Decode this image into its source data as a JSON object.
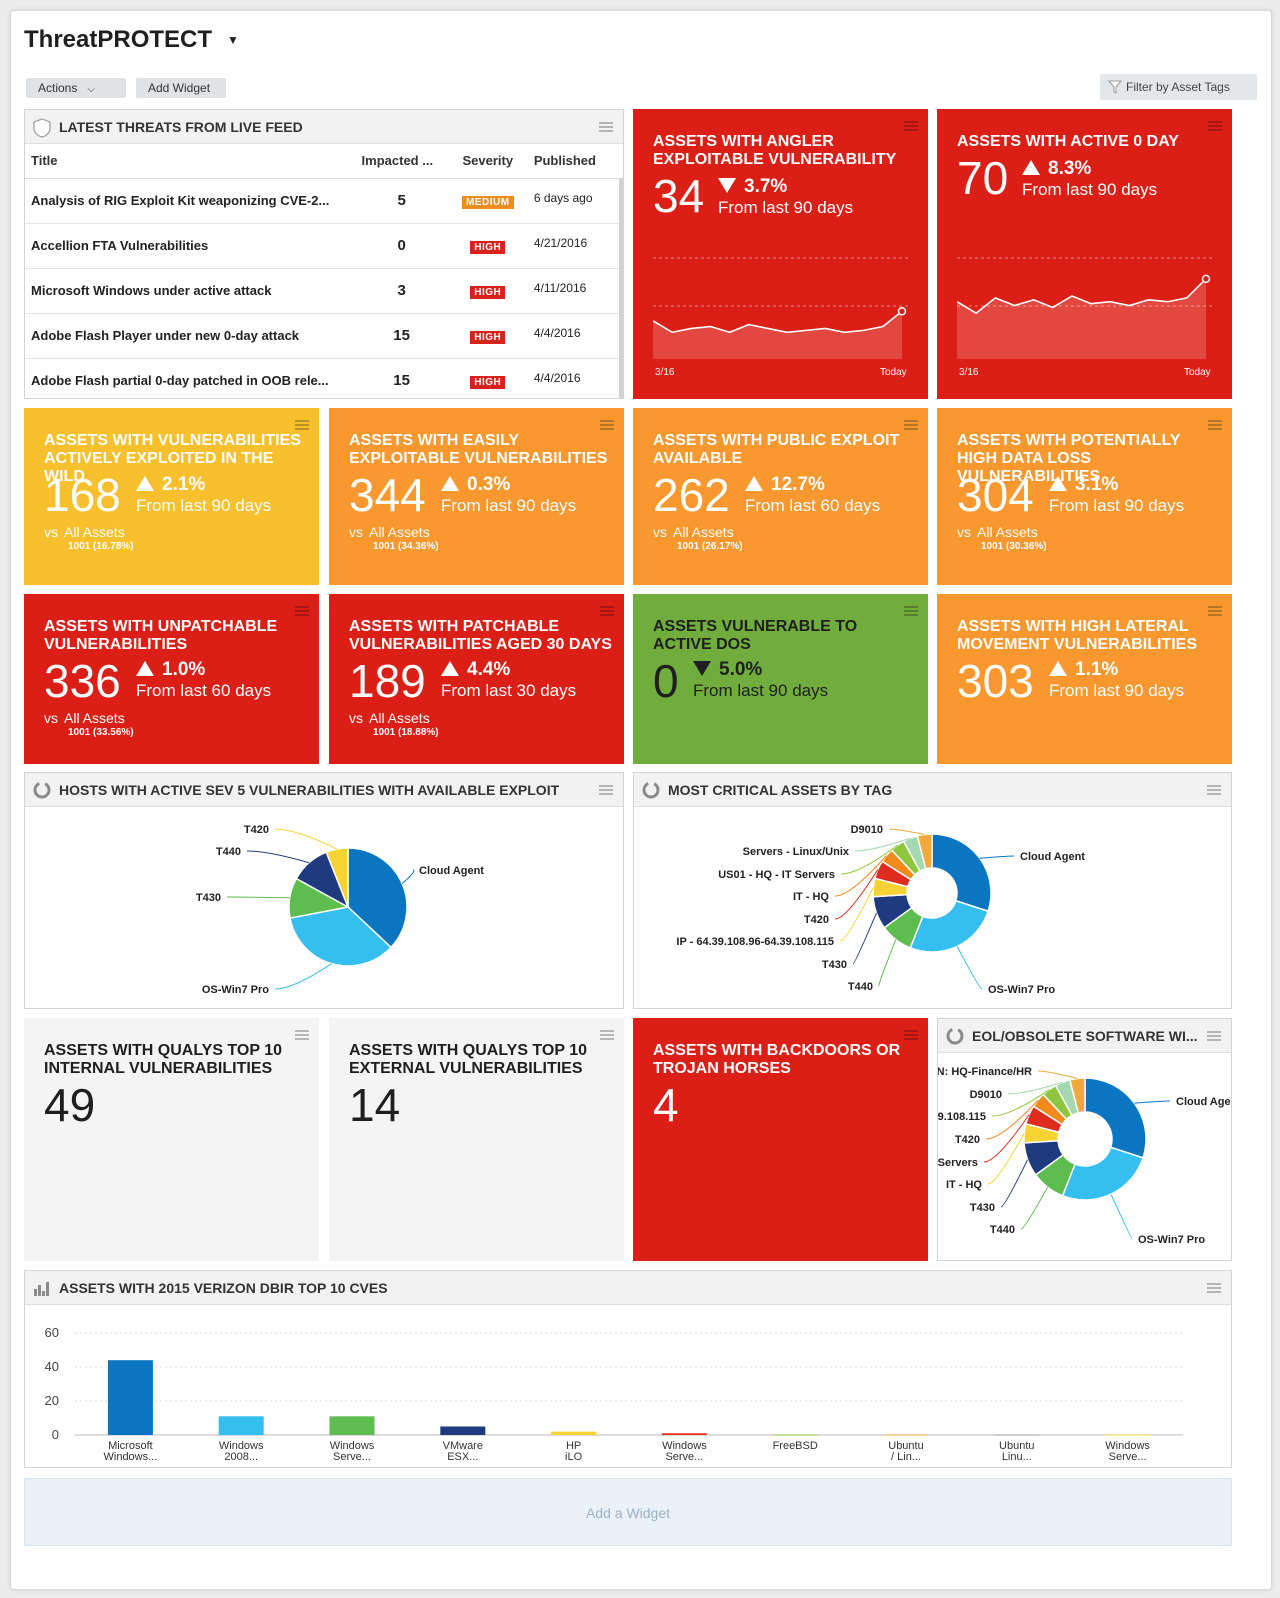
{
  "header": {
    "title": "ThreatPROTECT",
    "actions_label": "Actions",
    "add_widget_label": "Add Widget",
    "filter_label": "Filter by Asset Tags"
  },
  "threats": {
    "title": "LATEST THREATS FROM LIVE FEED",
    "columns": [
      "Title",
      "Impacted ...",
      "Severity",
      "Published"
    ],
    "rows": [
      {
        "title": "Analysis of RIG Exploit Kit weaponizing CVE-2...",
        "impacted": "5",
        "severity": "MEDIUM",
        "published": "6 days ago"
      },
      {
        "title": "Accellion FTA Vulnerabilities",
        "impacted": "0",
        "severity": "HIGH",
        "published": "4/21/2016"
      },
      {
        "title": "Microsoft Windows under active attack",
        "impacted": "3",
        "severity": "HIGH",
        "published": "4/11/2016"
      },
      {
        "title": "Adobe Flash Player under new 0-day attack",
        "impacted": "15",
        "severity": "HIGH",
        "published": "4/4/2016"
      },
      {
        "title": "Adobe Flash partial 0-day patched in OOB rele...",
        "impacted": "15",
        "severity": "HIGH",
        "published": "4/4/2016"
      }
    ],
    "severity_colors": {
      "MEDIUM": "#f08c1e",
      "HIGH": "#d8231c"
    }
  },
  "sparks": [
    {
      "title": "ASSETS WITH ANGLER EXPLOITABLE VULNERABILITY",
      "value": "34",
      "pct": "3.7%",
      "dir": "down",
      "sub": "From last 90 days",
      "start_label": "3/16",
      "end_label": "Today",
      "trend": [
        40,
        34,
        36,
        37,
        34,
        38,
        36,
        34,
        35,
        36,
        34,
        35,
        37,
        45
      ]
    },
    {
      "title": "ASSETS WITH ACTIVE 0 DAY",
      "value": "70",
      "pct": "8.3%",
      "dir": "up",
      "sub": "From last 90 days",
      "start_label": "3/16",
      "end_label": "Today",
      "trend": [
        50,
        44,
        52,
        48,
        51,
        47,
        53,
        49,
        50,
        48,
        51,
        50,
        52,
        62
      ]
    }
  ],
  "tiles": [
    {
      "title": "ASSETS WITH VULNERABILITIES ACTIVELY EXPLOITED IN THE WILD",
      "value": "168",
      "pct": "2.1%",
      "dir": "up",
      "sub": "From last 90 days",
      "vs": "vs",
      "vs_label": "All Assets",
      "vs_total": "1001",
      "vs_pct": "(16.78%)",
      "color": "#f9c02d"
    },
    {
      "title": "ASSETS WITH EASILY EXPLOITABLE VULNERABILITIES",
      "value": "344",
      "pct": "0.3%",
      "dir": "up",
      "sub": "From last 90 days",
      "vs": "vs",
      "vs_label": "All Assets",
      "vs_total": "1001",
      "vs_pct": "(34.36%)",
      "color": "#f9982f"
    },
    {
      "title": "ASSETS WITH PUBLIC EXPLOIT AVAILABLE",
      "value": "262",
      "pct": "12.7%",
      "dir": "up",
      "sub": "From last 60 days",
      "vs": "vs",
      "vs_label": "All Assets",
      "vs_total": "1001",
      "vs_pct": "(26.17%)",
      "color": "#f9982f"
    },
    {
      "title": "ASSETS WITH POTENTIALLY HIGH DATA LOSS VULNERABILITIES",
      "value": "304",
      "pct": "3.1%",
      "dir": "up",
      "sub": "From last 90 days",
      "vs": "vs",
      "vs_label": "All Assets",
      "vs_total": "1001",
      "vs_pct": "(30.36%)",
      "color": "#f9982f"
    },
    {
      "title": "ASSETS WITH UNPATCHABLE VULNERABILITIES",
      "value": "336",
      "pct": "1.0%",
      "dir": "up",
      "sub": "From last 60 days",
      "vs": "vs",
      "vs_label": "All Assets",
      "vs_total": "1001",
      "vs_pct": "(33.56%)",
      "color": "#dc1f16"
    },
    {
      "title": "ASSETS WITH PATCHABLE VULNERABILITIES AGED 30 DAYS",
      "value": "189",
      "pct": "4.4%",
      "dir": "up",
      "sub": "From last 30 days",
      "vs": "vs",
      "vs_label": "All Assets",
      "vs_total": "1001",
      "vs_pct": "(18.88%)",
      "color": "#dc1f16"
    },
    {
      "title": "ASSETS VULNERABLE TO ACTIVE DOS",
      "value": "0",
      "pct": "5.0%",
      "dir": "down",
      "sub": "From last 90 days",
      "color": "#70ad3c",
      "dark": true
    },
    {
      "title": "ASSETS WITH HIGH LATERAL MOVEMENT VULNERABILITIES",
      "value": "303",
      "pct": "1.1%",
      "dir": "up",
      "sub": "From last 90 days",
      "color": "#f9982f"
    }
  ],
  "simple_tiles": [
    {
      "title": "ASSETS WITH QUALYS TOP 10 INTERNAL VULNERABILITIES",
      "value": "49",
      "color": "#f4f4f4",
      "dark": true
    },
    {
      "title": "ASSETS WITH QUALYS TOP 10 EXTERNAL VULNERABILITIES",
      "value": "14",
      "color": "#f4f4f4",
      "dark": true
    },
    {
      "title": "ASSETS WITH BACKDOORS OR TROJAN HORSES",
      "value": "4",
      "color": "#dc1f16"
    }
  ],
  "pies": {
    "hosts_title": "HOSTS WITH ACTIVE SEV 5 VULNERABILITIES WITH AVAILABLE EXPLOIT",
    "critical_title": "MOST CRITICAL ASSETS BY TAG",
    "eol_title": "EOL/OBSOLETE SOFTWARE WI..."
  },
  "chart_data": [
    {
      "type": "pie",
      "title": "HOSTS WITH ACTIVE SEV 5 VULNERABILITIES WITH AVAILABLE EXPLOIT",
      "labels": [
        "Cloud Agent",
        "OS-Win7 Pro",
        "T430",
        "T440",
        "T420"
      ],
      "values": [
        37,
        35,
        11,
        11,
        6
      ],
      "colors": [
        "#0a76c2",
        "#35bef0",
        "#5ebd4f",
        "#1f3b7f",
        "#f6d332"
      ]
    },
    {
      "type": "pie",
      "title": "MOST CRITICAL ASSETS BY TAG",
      "labels": [
        "Cloud Agent",
        "OS-Win7 Pro",
        "T440",
        "T430",
        "IP - 64.39.108.96-64.39.108.115",
        "T420",
        "IT - HQ",
        "US01 - HQ - IT Servers",
        "Servers - Linux/Unix",
        "D9010"
      ],
      "values": [
        30,
        26,
        9,
        9,
        5,
        5,
        4,
        4,
        4,
        4
      ],
      "colors": [
        "#0a76c2",
        "#35bef0",
        "#5ebd4f",
        "#1f3b7f",
        "#f6d332",
        "#e02c1f",
        "#f28a1c",
        "#8ec63f",
        "#a4d8b0",
        "#f2a93b"
      ]
    },
    {
      "type": "pie",
      "title": "EOL/OBSOLETE SOFTWARE WI...",
      "labels": [
        "Cloud Age",
        "OS-Win7 Pro",
        "T440",
        "T430",
        "IT - HQ",
        "Servers",
        "T420",
        "9.108.115",
        "D9010",
        "N: HQ-Finance/HR"
      ],
      "values": [
        30,
        26,
        9,
        9,
        5,
        5,
        4,
        4,
        4,
        4
      ],
      "colors": [
        "#0a76c2",
        "#35bef0",
        "#5ebd4f",
        "#1f3b7f",
        "#f6d332",
        "#e02c1f",
        "#f28a1c",
        "#8ec63f",
        "#a4d8b0",
        "#f2a93b"
      ]
    },
    {
      "type": "bar",
      "title": "ASSETS WITH 2015 VERIZON DBIR TOP 10 CVES",
      "categories": [
        "Microsoft Windows...",
        "Windows 2008...",
        "Windows Serve...",
        "VMware ESX...",
        "HP iLO",
        "Windows Serve...",
        "FreeBSD",
        "Ubuntu / Lin...",
        "Ubuntu Linu...",
        "Windows Serve..."
      ],
      "category_lines": [
        [
          "Microsoft",
          "Windows..."
        ],
        [
          "Windows",
          "2008..."
        ],
        [
          "Windows",
          "Serve..."
        ],
        [
          "VMware",
          "ESX..."
        ],
        [
          "HP",
          "iLO"
        ],
        [
          "Windows",
          "Serve..."
        ],
        [
          "FreeBSD"
        ],
        [
          "Ubuntu",
          "/ Lin..."
        ],
        [
          "Ubuntu",
          "Linu..."
        ],
        [
          "Windows",
          "Serve..."
        ]
      ],
      "values": [
        44,
        11,
        11,
        5,
        2,
        1,
        0.3,
        0.3,
        0.3,
        0.3
      ],
      "colors": [
        "#0a76c2",
        "#35bef0",
        "#5ebd4f",
        "#1f3b7f",
        "#f6d332",
        "#e02c1f",
        "#8ec63f",
        "#f2a93b",
        "#a0a0a0",
        "#f6d332"
      ],
      "ylim": [
        0,
        60
      ],
      "yticks": [
        0,
        20,
        40,
        60
      ]
    }
  ],
  "bar_title": "ASSETS WITH 2015 VERIZON DBIR TOP 10 CVES",
  "footer": {
    "add_widget": "Add a Widget"
  }
}
